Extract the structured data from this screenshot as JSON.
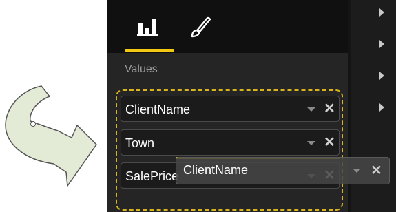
{
  "toolbar": {
    "tabs": [
      {
        "icon": "bar-chart-icon",
        "active": true
      },
      {
        "icon": "paintbrush-icon",
        "active": false
      }
    ]
  },
  "values_section": {
    "label": "Values",
    "fields": [
      {
        "label": "ClientName",
        "icons": [
          "chevron-down-icon",
          "close-icon"
        ]
      },
      {
        "label": "Town",
        "icons": [
          "chevron-down-icon",
          "close-icon"
        ]
      },
      {
        "label": "SalePrice",
        "icons": [
          "chevron-down-icon",
          "close-icon"
        ]
      }
    ]
  },
  "drag_ghost": {
    "label": "ClientName",
    "icons": [
      "chevron-down-icon",
      "close-icon"
    ]
  },
  "colors": {
    "accent": "#f2c811",
    "panel": "#252525",
    "header": "#101010",
    "arrow_fill": "#e3ead6"
  }
}
